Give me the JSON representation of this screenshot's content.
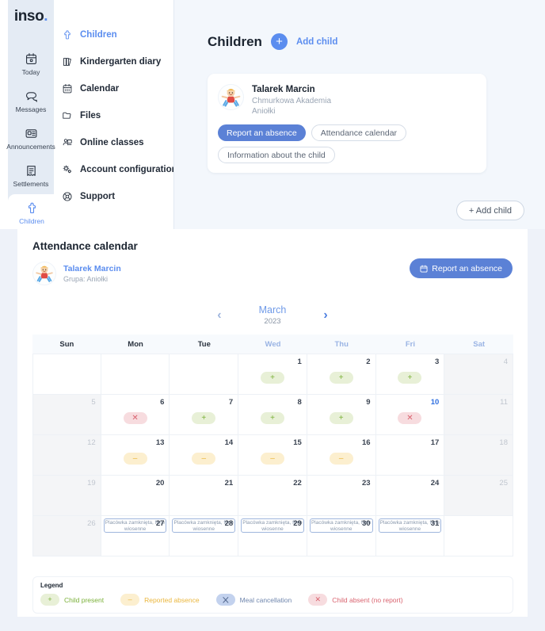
{
  "brand": {
    "name": "inso",
    "dot": ".",
    "accent": "#5b8def"
  },
  "rail": {
    "items": [
      {
        "label": "Today",
        "icon": "calendar-today-icon",
        "active": false
      },
      {
        "label": "Messages",
        "icon": "messages-icon",
        "active": false
      },
      {
        "label": "Announcements",
        "icon": "announcements-icon",
        "active": false
      },
      {
        "label": "Settlements",
        "icon": "settlements-icon",
        "active": false
      },
      {
        "label": "Children",
        "icon": "children-icon",
        "active": true
      }
    ]
  },
  "nav": {
    "items": [
      {
        "label": "Children",
        "icon": "children-icon",
        "active": true
      },
      {
        "label": "Kindergarten diary",
        "icon": "diary-icon",
        "active": false
      },
      {
        "label": "Calendar",
        "icon": "calendar-icon",
        "active": false
      },
      {
        "label": "Files",
        "icon": "folder-icon",
        "active": false
      },
      {
        "label": "Online classes",
        "icon": "online-classes-icon",
        "active": false
      },
      {
        "label": "Account configuration",
        "icon": "gear-icon",
        "active": false
      },
      {
        "label": "Support",
        "icon": "support-icon",
        "active": false
      }
    ]
  },
  "children_panel": {
    "title": "Children",
    "add_plus": "+",
    "add_link": "Add child",
    "add_child_button": "+ Add child",
    "card": {
      "name": "Talarek Marcin",
      "school": "Chmurkowa Akademia",
      "group": "Aniołki",
      "buttons": [
        {
          "label": "Report an absence",
          "style": "primary"
        },
        {
          "label": "Attendance calendar",
          "style": "outline"
        },
        {
          "label": "Information about the child",
          "style": "outline"
        }
      ]
    }
  },
  "attendance": {
    "title": "Attendance calendar",
    "student": {
      "name": "Talarek Marcin",
      "group_label": "Grupa: Aniołki"
    },
    "report_button": "Report an absence",
    "month": {
      "name": "March",
      "year": "2023",
      "prev": "‹",
      "next": "›"
    },
    "weekdays": [
      {
        "label": "Sun",
        "weekend": false,
        "muted": false
      },
      {
        "label": "Mon",
        "weekend": false,
        "muted": false
      },
      {
        "label": "Tue",
        "weekend": false,
        "muted": false
      },
      {
        "label": "Wed",
        "weekend": false,
        "muted": true
      },
      {
        "label": "Thu",
        "weekend": false,
        "muted": true
      },
      {
        "label": "Fri",
        "weekend": false,
        "muted": true
      },
      {
        "label": "Sat",
        "weekend": true,
        "muted": true
      }
    ],
    "cells": [
      {
        "day": "",
        "dim": false,
        "status": ""
      },
      {
        "day": "",
        "dim": false,
        "status": ""
      },
      {
        "day": "",
        "dim": false,
        "status": ""
      },
      {
        "day": "1",
        "dim": false,
        "status": "present"
      },
      {
        "day": "2",
        "dim": false,
        "status": "present"
      },
      {
        "day": "3",
        "dim": false,
        "status": "present"
      },
      {
        "day": "4",
        "dim": true,
        "status": ""
      },
      {
        "day": "5",
        "dim": true,
        "status": ""
      },
      {
        "day": "6",
        "dim": false,
        "status": "absent-norep"
      },
      {
        "day": "7",
        "dim": false,
        "status": "present"
      },
      {
        "day": "8",
        "dim": false,
        "status": "present"
      },
      {
        "day": "9",
        "dim": false,
        "status": "present"
      },
      {
        "day": "10",
        "dim": false,
        "status": "absent-norep",
        "today": true
      },
      {
        "day": "11",
        "dim": true,
        "status": ""
      },
      {
        "day": "12",
        "dim": true,
        "status": ""
      },
      {
        "day": "13",
        "dim": false,
        "status": "absent-rep"
      },
      {
        "day": "14",
        "dim": false,
        "status": "absent-rep"
      },
      {
        "day": "15",
        "dim": false,
        "status": "absent-rep"
      },
      {
        "day": "16",
        "dim": false,
        "status": "absent-rep"
      },
      {
        "day": "17",
        "dim": false,
        "status": ""
      },
      {
        "day": "18",
        "dim": true,
        "status": ""
      },
      {
        "day": "19",
        "dim": true,
        "status": ""
      },
      {
        "day": "20",
        "dim": false,
        "status": ""
      },
      {
        "day": "21",
        "dim": false,
        "status": ""
      },
      {
        "day": "22",
        "dim": false,
        "status": ""
      },
      {
        "day": "23",
        "dim": false,
        "status": ""
      },
      {
        "day": "24",
        "dim": false,
        "status": ""
      },
      {
        "day": "25",
        "dim": true,
        "status": ""
      },
      {
        "day": "26",
        "dim": true,
        "status": ""
      },
      {
        "day": "27",
        "dim": false,
        "status": "",
        "event": "Placówka zamknięta, ferie wiosenne"
      },
      {
        "day": "28",
        "dim": false,
        "status": "",
        "event": "Placówka zamknięta, ferie wiosenne"
      },
      {
        "day": "29",
        "dim": false,
        "status": "",
        "event": "Placówka zamknięta, ferie wiosenne"
      },
      {
        "day": "30",
        "dim": false,
        "status": "",
        "event": "Placówka zamknięta, ferie wiosenne"
      },
      {
        "day": "31",
        "dim": false,
        "status": "",
        "event": "Placówka zamknięta, ferie wiosenne"
      },
      {
        "day": "",
        "dim": false,
        "status": ""
      }
    ]
  },
  "legend": {
    "title": "Legend",
    "items": [
      {
        "glyph": "+",
        "label": "Child present",
        "kind": "present"
      },
      {
        "glyph": "–",
        "label": "Reported absence",
        "kind": "absent-rep"
      },
      {
        "glyph": "✕",
        "label": "Meal cancellation",
        "kind": "meal"
      },
      {
        "glyph": "✕",
        "label": "Child absent (no report)",
        "kind": "absent-norep"
      }
    ]
  },
  "colors": {
    "accent": "#5b8def",
    "primary_button": "#5b81d6",
    "present": "#7ab038",
    "reported": "#eab63c",
    "meal": "#53688f",
    "absent": "#d9636f"
  }
}
